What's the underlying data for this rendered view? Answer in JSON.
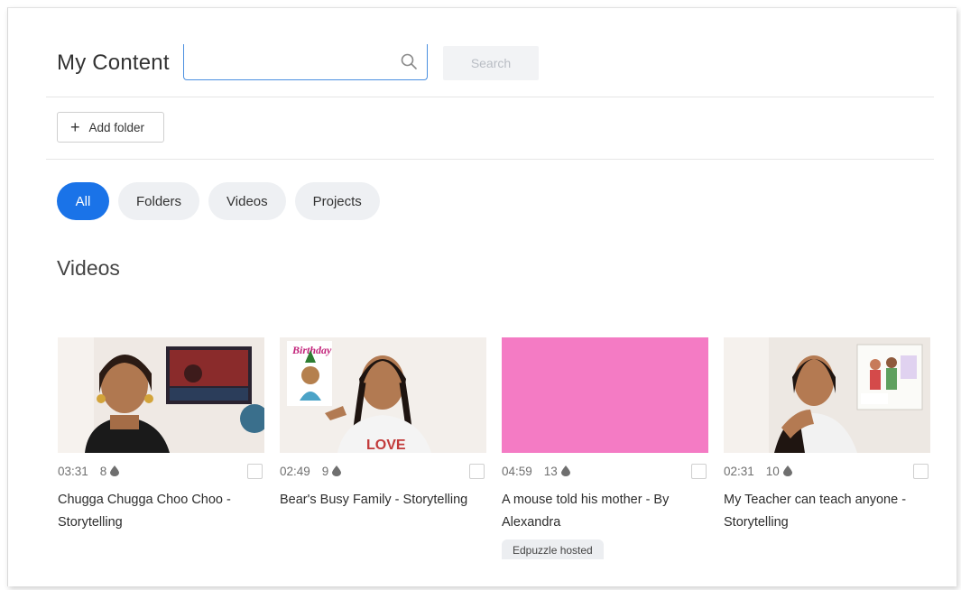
{
  "header": {
    "title": "My Content",
    "search_placeholder": "",
    "search_button": "Search"
  },
  "toolbar": {
    "add_folder_label": "Add folder"
  },
  "filters": [
    {
      "label": "All",
      "active": true
    },
    {
      "label": "Folders",
      "active": false
    },
    {
      "label": "Videos",
      "active": false
    },
    {
      "label": "Projects",
      "active": false
    }
  ],
  "section_title": "Videos",
  "colors": {
    "accent": "#1a73e8",
    "pink_thumbnail": "#f47bc4"
  },
  "videos": [
    {
      "duration": "03:31",
      "questions": "8",
      "title": "Chugga Chugga Choo Choo - Storytelling",
      "badge": ""
    },
    {
      "duration": "02:49",
      "questions": "9",
      "title": "Bear's Busy Family - Storytelling",
      "badge": "",
      "thumb_text": "Birthday",
      "shirt_text": "LOVE"
    },
    {
      "duration": "04:59",
      "questions": "13",
      "title": "A mouse told his mother - By Alexandra",
      "badge": "Edpuzzle hosted"
    },
    {
      "duration": "02:31",
      "questions": "10",
      "title": "My Teacher can teach anyone - Storytelling",
      "badge": ""
    }
  ]
}
